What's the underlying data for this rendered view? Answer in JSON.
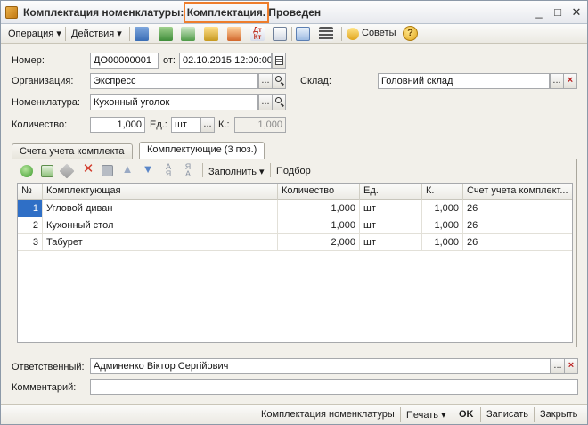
{
  "window": {
    "title_prefix": "Комплектация номенклатуры: ",
    "title_highlight": "Комплектация.",
    "title_suffix": " Проведен",
    "minimize": "_",
    "maximize": "□",
    "close": "✕"
  },
  "toolbar": {
    "operation": "Операция ▾",
    "actions": "Действия ▾",
    "advice": "Советы",
    "help": "?"
  },
  "form": {
    "number_label": "Номер:",
    "number_value": "ДО00000001",
    "date_label": "от:",
    "date_value": "02.10.2015 12:00:00",
    "org_label": "Организация:",
    "org_value": "Экспресс",
    "warehouse_label": "Склад:",
    "warehouse_value": "Головний склад",
    "item_label": "Номенклатура:",
    "item_value": "Кухонный уголок",
    "qty_label": "Количество:",
    "qty_value": "1,000",
    "unit_label": "Ед.:",
    "unit_value": "шт",
    "k_label": "К.:",
    "k_value": "1,000",
    "ellipsis": "...",
    "clear": "×"
  },
  "tabs": [
    {
      "label": "Счета учета комплекта"
    },
    {
      "label": "Комплектующие (3 поз.)"
    }
  ],
  "subtoolbar": {
    "fill": "Заполнить ▾",
    "pick": "Подбор"
  },
  "table": {
    "headers": [
      "№",
      "Комплектующая",
      "Количество",
      "Ед.",
      "К.",
      "Счет учета комплект..."
    ],
    "rows": [
      {
        "n": "1",
        "name": "Угловой диван",
        "qty": "1,000",
        "unit": "шт",
        "k": "1,000",
        "acct": "26"
      },
      {
        "n": "2",
        "name": "Кухонный стол",
        "qty": "1,000",
        "unit": "шт",
        "k": "1,000",
        "acct": "26"
      },
      {
        "n": "3",
        "name": "Табурет",
        "qty": "2,000",
        "unit": "шт",
        "k": "1,000",
        "acct": "26"
      }
    ]
  },
  "footer": {
    "responsible_label": "Ответственный:",
    "responsible_value": "Админенко Віктор Сергійович",
    "comment_label": "Комментарий:",
    "comment_value": ""
  },
  "bottombar": {
    "doc_link": "Комплектация номенклатуры",
    "print": "Печать ▾",
    "ok": "OK",
    "save": "Записать",
    "close": "Закрыть"
  }
}
